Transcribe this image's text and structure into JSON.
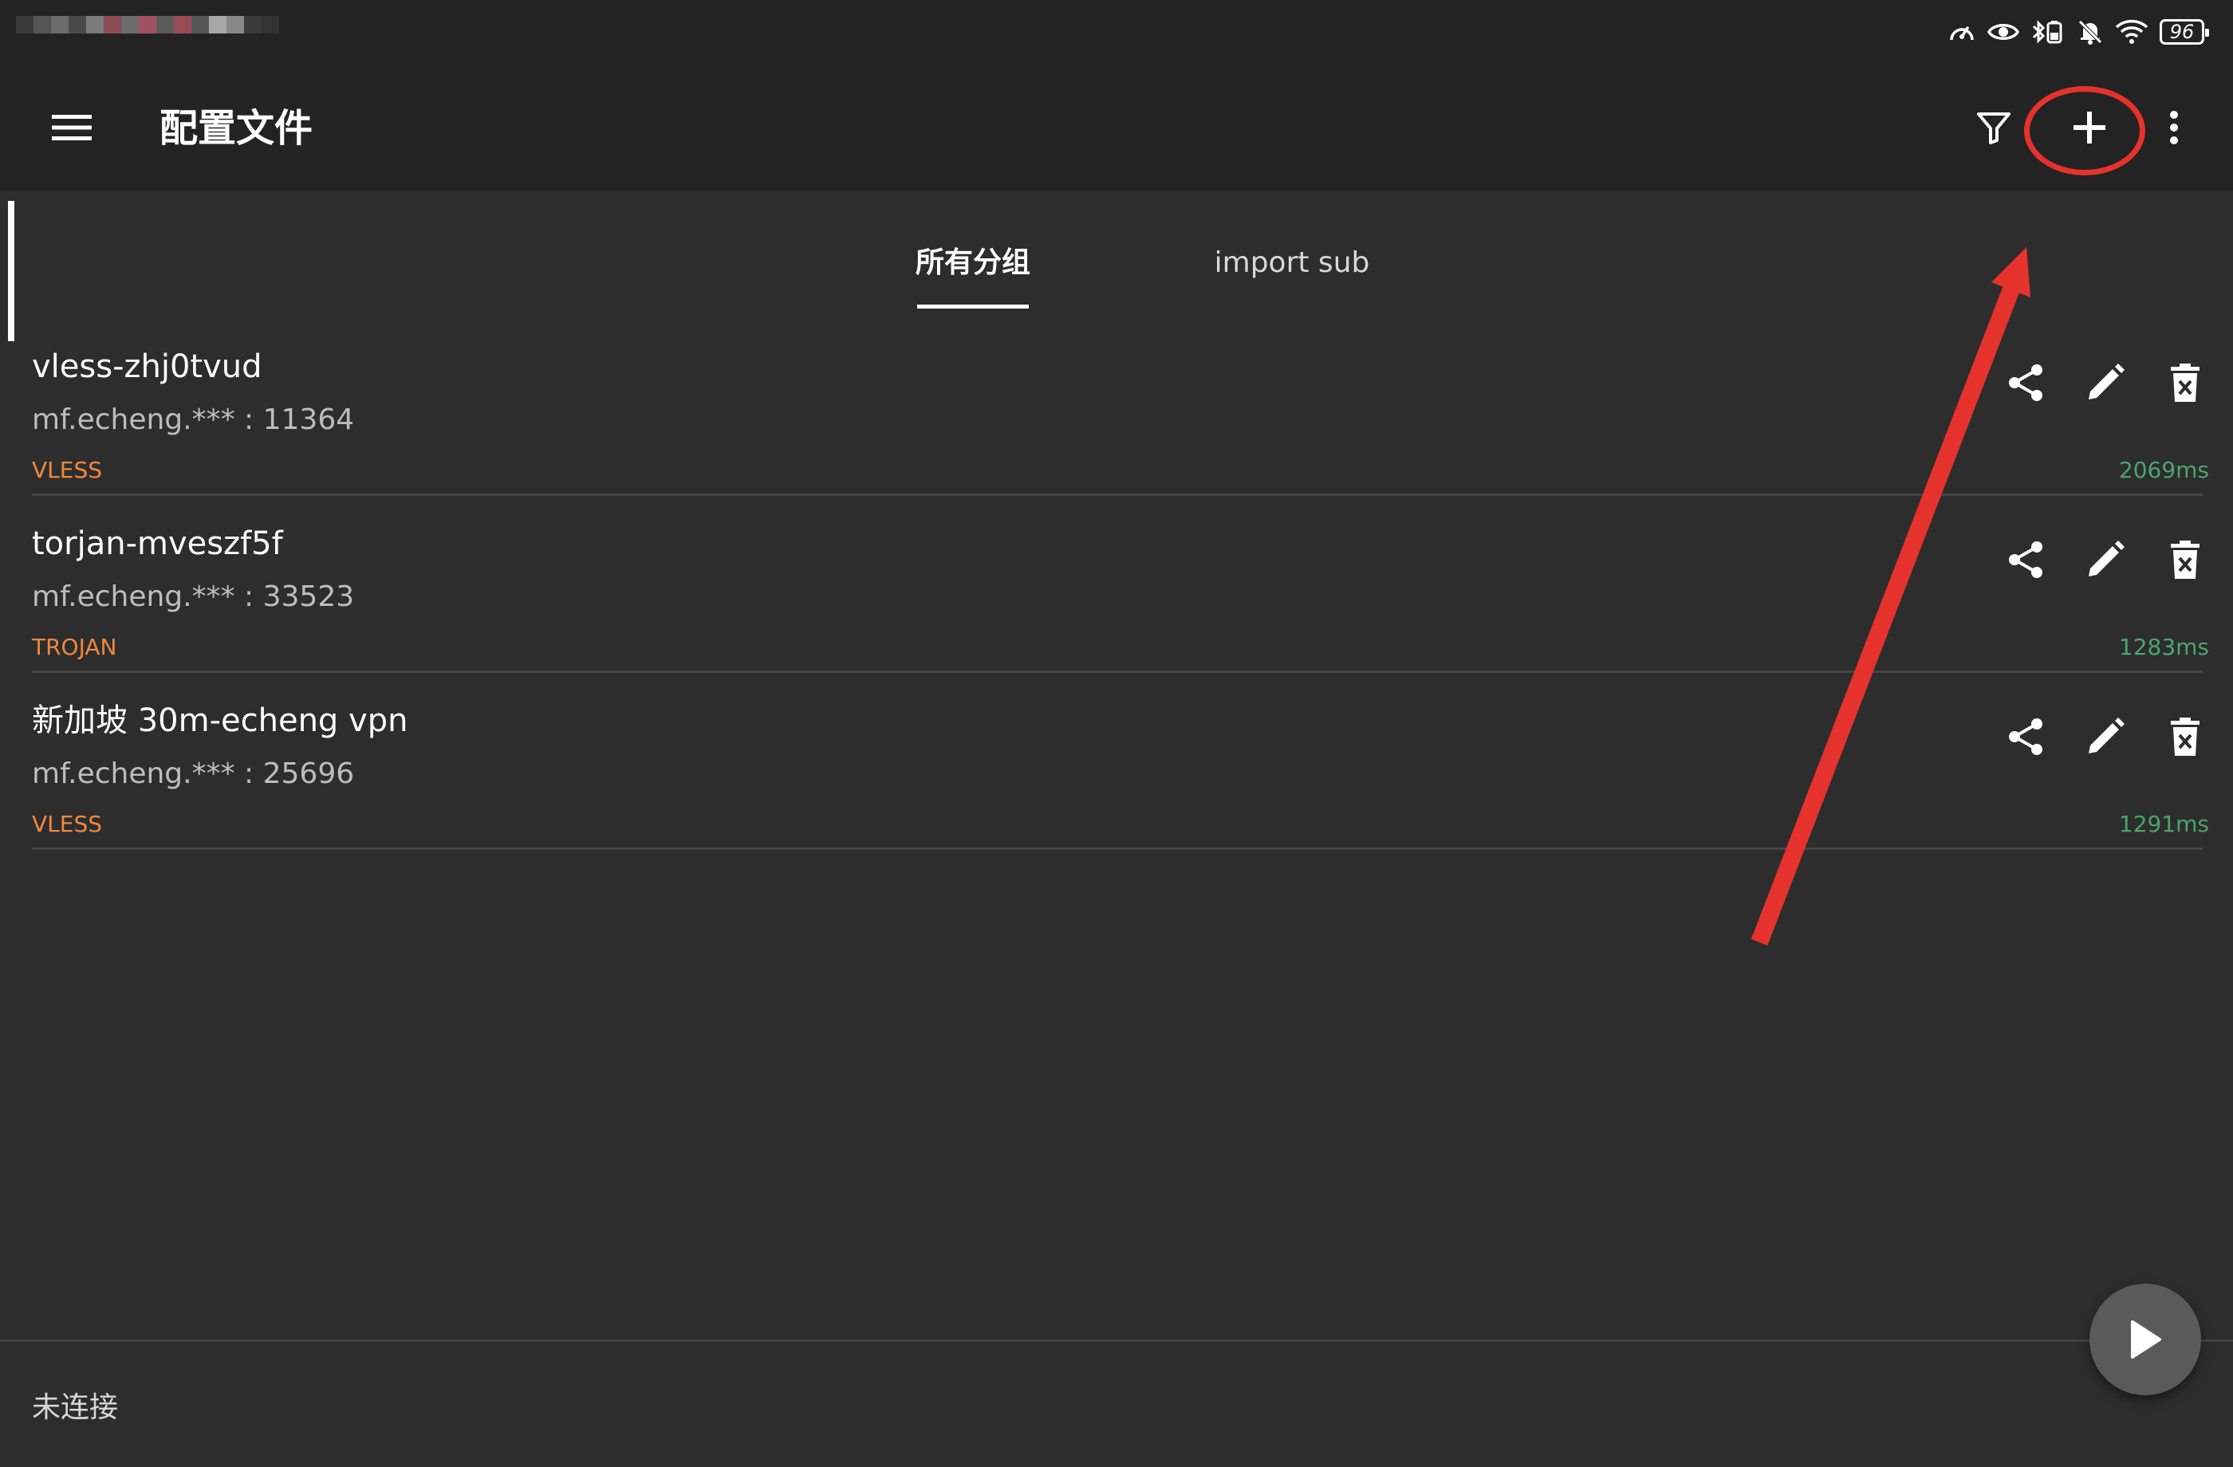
{
  "app": {
    "title": "配置文件",
    "accent_color": "#ffffff",
    "highlight_color": "#e5322d"
  },
  "status_bar": {
    "icons": [
      "speedometer-icon",
      "eye-icon",
      "bluetooth-battery-icon",
      "bell-off-icon",
      "wifi-icon"
    ],
    "battery": "96"
  },
  "toolbar": {
    "menu_icon": "hamburger-menu-icon",
    "filter_icon": "filter-icon",
    "add_icon": "plus-icon",
    "more_icon": "more-vertical-icon"
  },
  "tabs": [
    {
      "label": "所有分组",
      "active": true
    },
    {
      "label": "import sub",
      "active": false
    }
  ],
  "profiles": [
    {
      "name": "vless-zhj0tvud",
      "address": "mf.echeng.*** : 11364",
      "protocol": "VLESS",
      "latency": "2069ms",
      "selected": false
    },
    {
      "name": "torjan-mveszf5f",
      "address": "mf.echeng.*** : 33523",
      "protocol": "TROJAN",
      "latency": "1283ms",
      "selected": true
    },
    {
      "name": "新加坡 30m-echeng vpn",
      "address": "mf.echeng.*** : 25696",
      "protocol": "VLESS",
      "latency": "1291ms",
      "selected": false
    }
  ],
  "row_actions": [
    "share-icon",
    "edit-icon",
    "delete-icon"
  ],
  "colors": {
    "protocol": "#f0883c",
    "latency": "#4aa56f",
    "background": "#2d2d2d",
    "bar": "#232323"
  },
  "bottom": {
    "status": "未连接",
    "fab_icon": "play-icon"
  }
}
